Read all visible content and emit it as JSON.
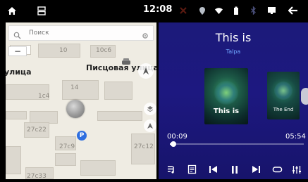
{
  "status_bar": {
    "time": "12:08",
    "icons": [
      "home-icon",
      "recent-apps-icon",
      "warning-icon",
      "location-pin-icon",
      "wifi-icon",
      "battery-icon",
      "bluetooth-icon",
      "screen-icon",
      "back-icon"
    ]
  },
  "map": {
    "search_placeholder": "Поиск",
    "street_left": "улица",
    "street_main": "Писцовая улица",
    "house_labels": [
      "10",
      "10с6",
      "1с4",
      "14",
      "27с22",
      "27с9",
      "27с12",
      "27с33"
    ],
    "zoom_out_label": "−",
    "parking_label": "P"
  },
  "player": {
    "title": "This is",
    "artist": "Talpa",
    "cover_main_caption": "This is",
    "cover_side_caption": "The End",
    "elapsed": "00:09",
    "total": "05:54",
    "progress_fraction": 0.026,
    "controls": [
      "playlist-icon",
      "equalizer-list-icon",
      "previous-track-icon",
      "pause-icon",
      "next-track-icon",
      "repeat-icon",
      "equalizer-settings-icon"
    ],
    "accent_color": "#6fa6ff",
    "background_color": "#1d1880"
  }
}
